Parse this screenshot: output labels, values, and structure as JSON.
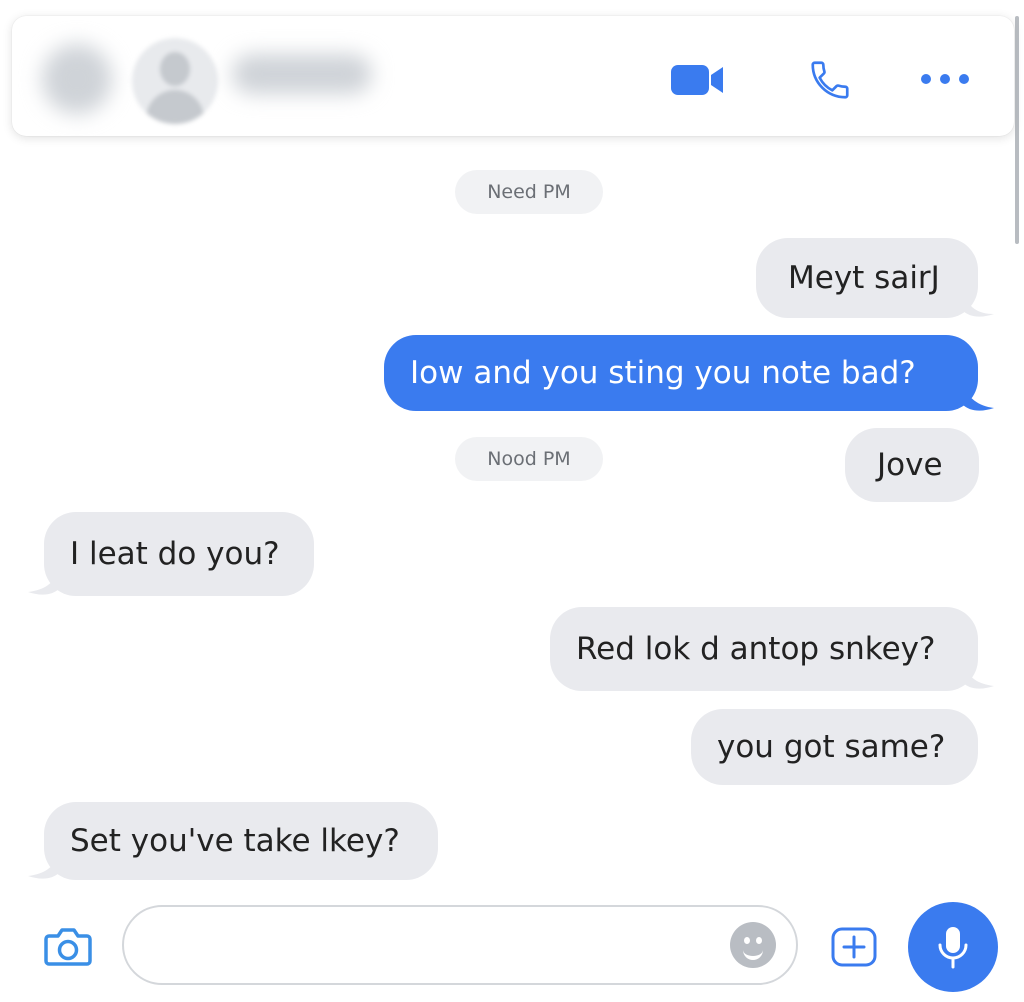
{
  "header": {
    "video_call_icon": "video-icon",
    "voice_call_icon": "phone-icon",
    "more_icon": "more-horizontal-icon"
  },
  "timestamps": [
    "Need PM",
    "Nood PM"
  ],
  "messages": [
    {
      "text": "Meyt sairJ",
      "side": "right",
      "style": "gray"
    },
    {
      "text": "Iow and you sting you note bad?",
      "side": "right",
      "style": "blue"
    },
    {
      "text": "Jove",
      "side": "right",
      "style": "gray"
    },
    {
      "text": "I leat do you?",
      "side": "left",
      "style": "gray"
    },
    {
      "text": "Red lok d antop snkey?",
      "side": "right",
      "style": "gray"
    },
    {
      "text": "you got same?",
      "side": "right",
      "style": "gray"
    },
    {
      "text": "Set you've take lkey?",
      "side": "left",
      "style": "gray"
    }
  ],
  "composer": {
    "message_value": "",
    "camera_icon": "camera-icon",
    "emoji_icon": "emoji-icon",
    "add_icon": "plus-icon",
    "mic_icon": "microphone-icon"
  },
  "colors": {
    "accent": "#3a7bef",
    "bubble_gray": "#e9eaee",
    "stamp_bg": "#f1f2f4"
  }
}
